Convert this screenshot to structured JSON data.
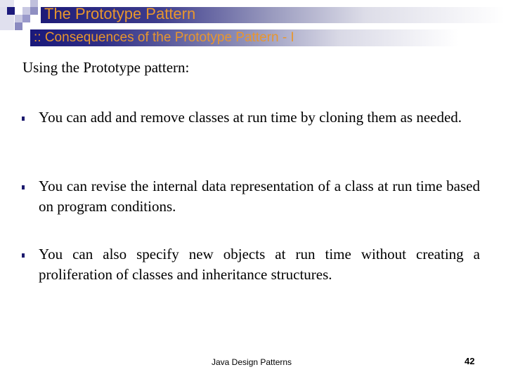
{
  "slide": {
    "title": "The Prototype Pattern",
    "subtitle": ":: Consequences of the Prototype Pattern - I",
    "intro": "Using the Prototype pattern:",
    "bullets": [
      "You can add and remove classes at run time by cloning them as needed.",
      "You can revise the internal data representation of a class at run time based on program conditions.",
      "You can also specify new objects at run time without creating a proliferation of classes and inheritance structures."
    ],
    "footer": "Java Design Patterns",
    "page_number": "42"
  },
  "colors": {
    "title_text": "#e8962e",
    "banner_dark": "#1e1b78",
    "bullet": "#1c1a6e"
  }
}
